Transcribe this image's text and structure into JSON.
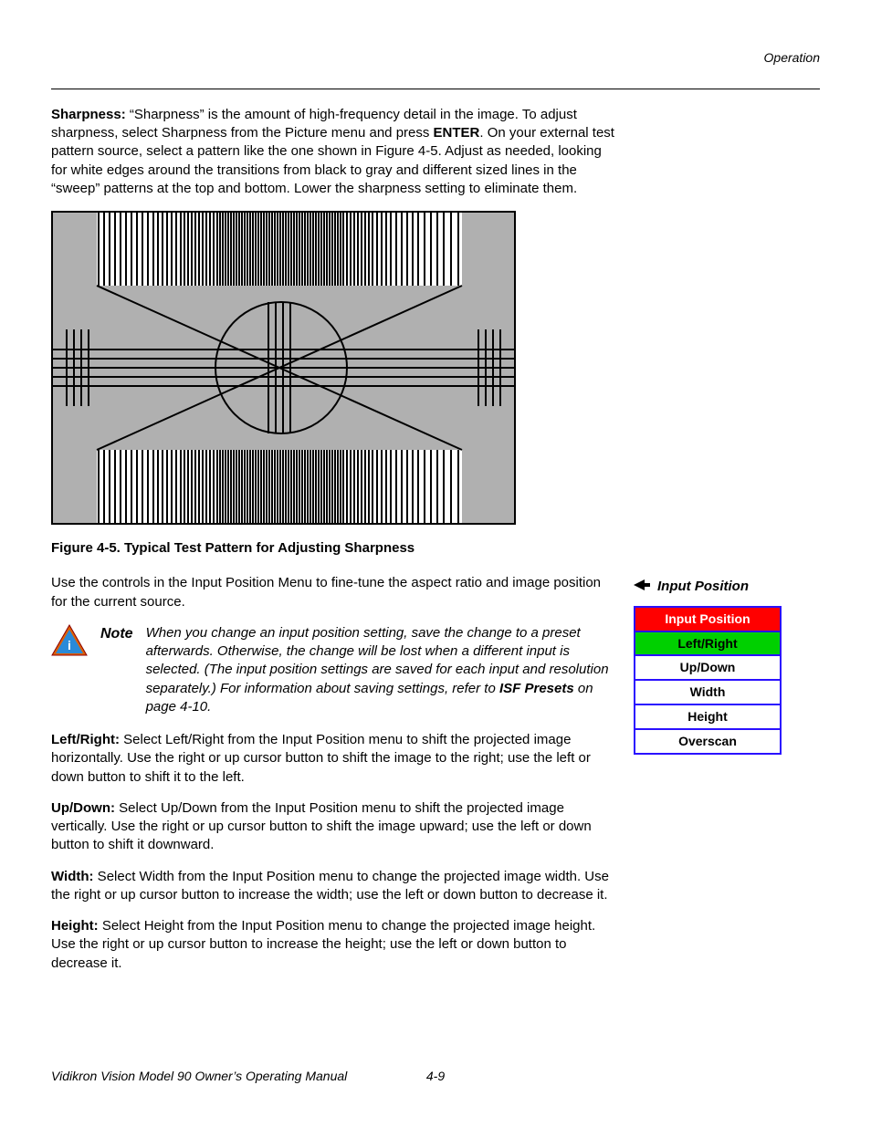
{
  "header": {
    "section": "Operation"
  },
  "sharpness": {
    "label": "Sharpness:",
    "text_before_enter": " “Sharpness” is the amount of high-frequency detail in the image. To adjust sharpness, select Sharpness from the Picture menu and press ",
    "enter": "ENTER",
    "text_after_enter": ". On your external test pattern source, select a pattern like the one shown in Figure 4-5. Adjust as needed, looking for white edges around the transitions from black to gray and different sized lines in the “sweep” patterns at the top and bottom. Lower the sharpness setting to eliminate them."
  },
  "figure_caption": "Figure 4-5. Typical Test Pattern for Adjusting Sharpness",
  "input_intro": "Use the controls in the Input Position Menu to fine-tune the aspect ratio and image position for the current source.",
  "note": {
    "label": "Note",
    "body_before_ref": "When you change an input position setting, save the change to a preset afterwards. Otherwise, the change will be lost when a different input is selected. (The input position settings are saved for each input and resolution separately.) For information about saving settings, refer to ",
    "ref": "ISF Presets",
    "body_after_ref": " on page 4-10."
  },
  "side_heading": "Input Position",
  "menu": {
    "title": "Input Position",
    "selected": "Left/Right",
    "items": [
      "Up/Down",
      "Width",
      "Height",
      "Overscan"
    ]
  },
  "items": {
    "left_right": {
      "label": "Left/Right:",
      "text": " Select Left/Right from the Input Position menu to shift the projected image horizontally. Use the right or up cursor button to shift the image to the right; use the left or down button to shift it to the left."
    },
    "up_down": {
      "label": "Up/Down:",
      "text": " Select Up/Down from the Input Position menu to shift the projected image vertically. Use the right or up cursor button to shift the image upward; use the left or down button to shift it downward."
    },
    "width": {
      "label": "Width:",
      "text": " Select Width from the Input Position menu to change the projected image width. Use the right or up cursor button to increase the width; use the left or down button to decrease it."
    },
    "height": {
      "label": "Height:",
      "text": " Select Height from the Input Position menu to change the projected image height. Use the right or up cursor button to increase the height; use the left or down button to decrease it."
    }
  },
  "footer": {
    "left": "Vidikron Vision Model 90 Owner’s Operating Manual",
    "right": "4-9"
  }
}
